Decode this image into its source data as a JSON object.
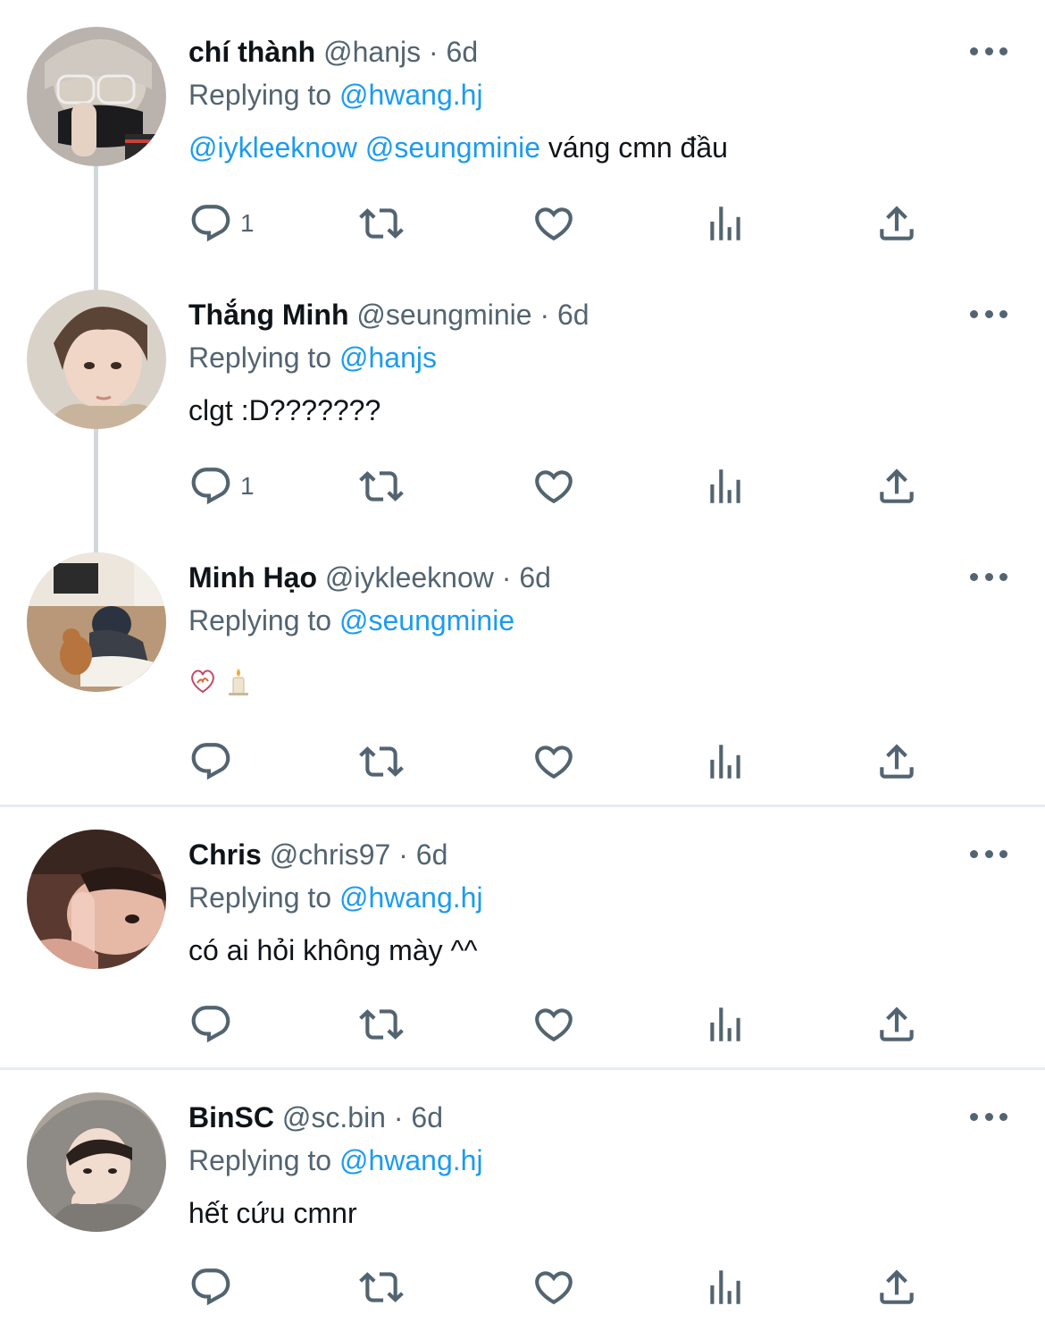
{
  "tweets": [
    {
      "name": "chí thành",
      "handle": "@hanjs",
      "dot": "·",
      "time": "6d",
      "replying_label": "Replying to",
      "replying_to": "@hwang.hj",
      "mentions": [
        "@iykleeknow",
        "@seungminie"
      ],
      "text": " váng cmn đầu",
      "reply_count": "1"
    },
    {
      "name": "Thắng Minh",
      "handle": "@seungminie",
      "dot": "·",
      "time": "6d",
      "replying_label": "Replying to",
      "replying_to": "@hanjs",
      "text": "clgt :D???????",
      "reply_count": "1"
    },
    {
      "name": "Minh Hạo",
      "handle": "@iykleeknow",
      "dot": "·",
      "time": "6d",
      "replying_label": "Replying to",
      "replying_to": "@seungminie",
      "emojis": [
        "heart-on-fire-icon",
        "candle-icon"
      ]
    },
    {
      "name": "Chris",
      "handle": "@chris97",
      "dot": "·",
      "time": "6d",
      "replying_label": "Replying to",
      "replying_to": "@hwang.hj",
      "text": "có ai hỏi không mày ^^"
    },
    {
      "name": "BinSC",
      "handle": "@sc.bin",
      "dot": "·",
      "time": "6d",
      "replying_label": "Replying to",
      "replying_to": "@hwang.hj",
      "text": "hết cứu cmnr"
    }
  ],
  "icons": {
    "reply": "reply-icon",
    "retweet": "retweet-icon",
    "like": "heart-icon",
    "views": "views-icon",
    "share": "share-icon",
    "more": "more-icon"
  },
  "colors": {
    "link": "#1d9bf0",
    "secondary": "#536471",
    "text": "#0f1419",
    "divider": "#e6ecf0",
    "thread_line": "#cfd9de"
  }
}
